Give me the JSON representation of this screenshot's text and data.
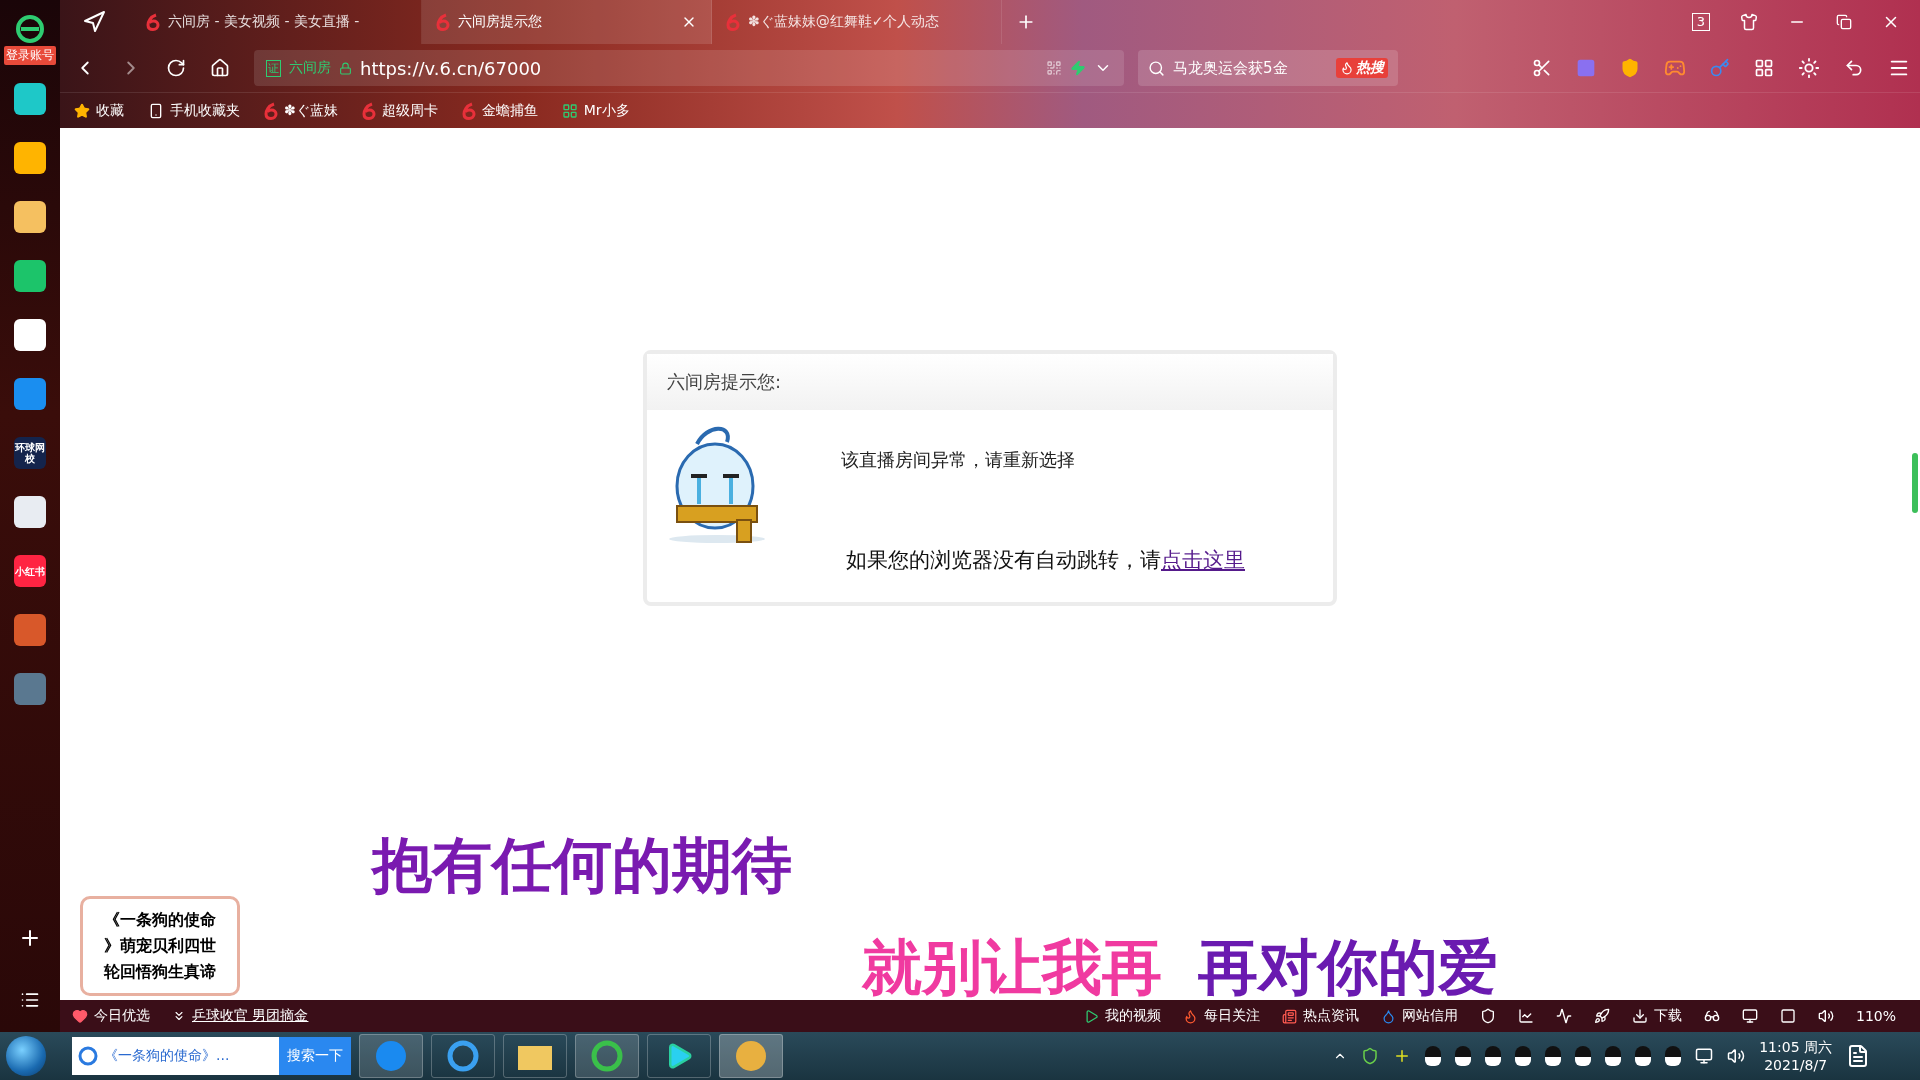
{
  "sidebar": {
    "account_label": "登录账号",
    "apps": [
      {
        "kind": "plain",
        "color": "#1ec8c8"
      },
      {
        "kind": "plain",
        "color": "#ffb400"
      },
      {
        "kind": "plain",
        "color": "#f5c060"
      },
      {
        "kind": "plain",
        "color": "#1cc46a"
      },
      {
        "kind": "plain",
        "color": "#ffffff"
      },
      {
        "kind": "plain",
        "color": "#1a8ef0"
      },
      {
        "kind": "text",
        "color": "#14244c",
        "label": "环球网校"
      },
      {
        "kind": "plain",
        "color": "#e8ecf2"
      },
      {
        "kind": "text",
        "color": "#ff2442",
        "label": "小红书"
      },
      {
        "kind": "plain",
        "color": "#d8582a"
      },
      {
        "kind": "plain",
        "color": "#5a7890"
      }
    ]
  },
  "tabs": [
    {
      "title": "六间房 - 美女视频 - 美女直播 -",
      "selected": false
    },
    {
      "title": "六间房提示您",
      "selected": true
    },
    {
      "title": "✽ぐ蓝妹妹@红舞鞋✓个人动态",
      "selected": false
    }
  ],
  "window_controls": {
    "tab_count": "3"
  },
  "address_bar": {
    "cert_badge": "证",
    "cert_label": "六间房",
    "url": "https://v.6.cn/67000"
  },
  "search": {
    "value": "马龙奥运会获5金",
    "hot_label": "热搜"
  },
  "bookmarks": [
    {
      "kind": "star",
      "label": "收藏"
    },
    {
      "kind": "phone",
      "label": "手机收藏夹"
    },
    {
      "kind": "six",
      "label": "✽ぐ蓝妹"
    },
    {
      "kind": "six",
      "label": "超级周卡"
    },
    {
      "kind": "six",
      "label": "金蟾捕鱼"
    },
    {
      "kind": "app",
      "label": "Mr小多"
    }
  ],
  "dialog": {
    "title": "六间房提示您:",
    "message": "该直播房间异常，请重新选择",
    "redirect_text": "如果您的浏览器没有自动跳转，请",
    "redirect_link": "点击这里"
  },
  "lyrics": [
    {
      "kind": "purple",
      "text": "抱有任何的期待"
    },
    {
      "kind": "mixed",
      "parts": [
        "就别让我再",
        "再对你的爱"
      ]
    }
  ],
  "promo_card": {
    "lines": [
      "《一条狗的使命",
      "》萌宠贝利四世",
      "轮回悟狗生真谛"
    ]
  },
  "status_bar": {
    "left": [
      {
        "kind": "heart",
        "label": "今日优选"
      },
      {
        "kind": "news",
        "label": "乒球收官 男团摘金"
      }
    ],
    "right": [
      {
        "kind": "play",
        "label": "我的视频"
      },
      {
        "kind": "fire",
        "label": "每日关注"
      },
      {
        "kind": "paper",
        "label": "热点资讯"
      },
      {
        "kind": "drop",
        "label": "网站信用"
      }
    ],
    "download": "下载",
    "zoom": "110%"
  },
  "taskbar": {
    "search_value": "《一条狗的使命》...",
    "search_button": "搜索一下",
    "time": "11:05 周六",
    "date": "2021/8/7"
  }
}
